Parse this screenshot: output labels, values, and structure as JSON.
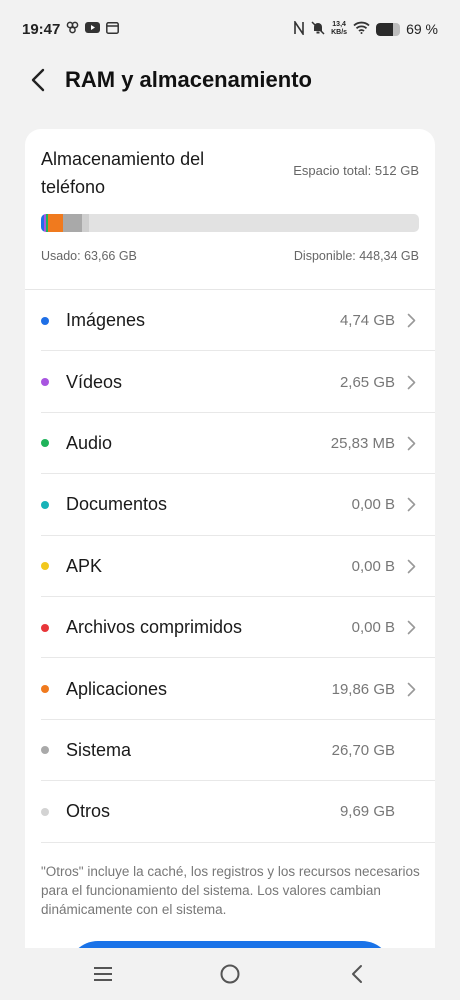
{
  "status_bar": {
    "time": "19:47",
    "net_speed_value": "13,4",
    "net_speed_unit": "KB/s",
    "battery_text": "69 %",
    "battery_level": 0.69
  },
  "header": {
    "title": "RAM y almacenamiento"
  },
  "storage": {
    "title": "Almacenamiento del teléfono",
    "total": "Espacio total: 512 GB",
    "used": "Usado: 63,66 GB",
    "available": "Disponible: 448,34 GB",
    "bar_segments": [
      {
        "name": "Imágenes",
        "gb": 4.74,
        "color": "#1f6fe6"
      },
      {
        "name": "Vídeos",
        "gb": 2.65,
        "color": "#a855e0"
      },
      {
        "name": "Audio",
        "gb": 0.026,
        "color": "#1fb35a"
      },
      {
        "name": "Aplicaciones",
        "gb": 19.86,
        "color": "#f07a1e"
      },
      {
        "name": "Sistema",
        "gb": 26.7,
        "color": "#a9a9a9"
      },
      {
        "name": "Otros",
        "gb": 9.69,
        "color": "#cfcfcf"
      }
    ],
    "total_gb": 512
  },
  "categories": [
    {
      "name": "Imágenes",
      "size": "4,74 GB",
      "color": "#1f6fe6",
      "chevron": true
    },
    {
      "name": "Vídeos",
      "size": "2,65 GB",
      "color": "#a855e0",
      "chevron": true
    },
    {
      "name": "Audio",
      "size": "25,83 MB",
      "color": "#1fb35a",
      "chevron": true
    },
    {
      "name": "Documentos",
      "size": "0,00 B",
      "color": "#17b3b8",
      "chevron": true
    },
    {
      "name": "APK",
      "size": "0,00 B",
      "color": "#f2c81d",
      "chevron": true
    },
    {
      "name": "Archivos comprimidos",
      "size": "0,00 B",
      "color": "#e8363a",
      "chevron": true
    },
    {
      "name": "Aplicaciones",
      "size": "19,86 GB",
      "color": "#f07a1e",
      "chevron": true
    },
    {
      "name": "Sistema",
      "size": "26,70 GB",
      "color": "#a9a9a9",
      "chevron": false
    },
    {
      "name": "Otros",
      "size": "9,69 GB",
      "color": "#d3d3d3",
      "chevron": false
    }
  ],
  "note": "\"Otros\" incluye la caché, los registros y los recursos necesarios para el funcionamiento del sistema. Los valores cambian dinámicamente con el sistema.",
  "colors": {
    "accent": "#1a73e8",
    "card_bg": "#ffffff",
    "page_bg": "#f2f2f2"
  },
  "icons": {
    "back": "chevron-left-icon",
    "row_arrow": "chevron-right-icon",
    "nav_menu": "menu-icon",
    "nav_home": "home-icon",
    "nav_back": "back-icon"
  }
}
